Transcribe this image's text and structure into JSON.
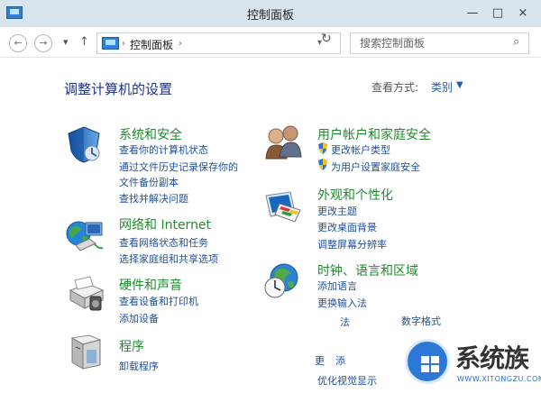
{
  "window": {
    "title": "控制面板"
  },
  "address": {
    "path": "控制面板",
    "search_placeholder": "搜索控制面板"
  },
  "main": {
    "heading": "调整计算机的设置",
    "view_by_label": "查看方式:",
    "view_by_value": "类别"
  },
  "categories": {
    "system": {
      "title": "系统和安全",
      "links": [
        "查看你的计算机状态",
        "通过文件历史记录保存你的",
        "文件备份副本",
        "查找并解决问题"
      ]
    },
    "network": {
      "title": "网络和 Internet",
      "links": [
        "查看网络状态和任务",
        "选择家庭组和共享选项"
      ]
    },
    "hardware": {
      "title": "硬件和声音",
      "links": [
        "查看设备和打印机",
        "添加设备"
      ]
    },
    "programs": {
      "title": "程序",
      "links": [
        "卸载程序"
      ]
    },
    "user": {
      "title": "用户帐户和家庭安全",
      "links": [
        "更改帐户类型",
        "为用户设置家庭安全"
      ]
    },
    "appearance": {
      "title": "外观和个性化",
      "links": [
        "更改主题",
        "更改桌面背景",
        "调整屏幕分辨率"
      ]
    },
    "clock": {
      "title": "时钟、语言和区域",
      "links": [
        "添加语言",
        "更换输入法",
        "法",
        "数字格式"
      ]
    },
    "ease": {
      "links": [
        "更",
        "添",
        "优化视觉显示"
      ]
    }
  },
  "watermark": {
    "brand": "系统族",
    "url": "WWW.XITONGZU.COM"
  },
  "colors": {
    "category_title": "#1f8a2e",
    "link": "#1f4f9a",
    "heading": "#1e3287",
    "titlebar": "#d8e5ed"
  },
  "icons": {
    "system": "shield-icon",
    "network": "globe-icon",
    "hardware": "printer-icon",
    "programs": "box-icon",
    "user": "users-icon",
    "appearance": "display-paint-icon",
    "clock": "globe-clock-icon"
  }
}
